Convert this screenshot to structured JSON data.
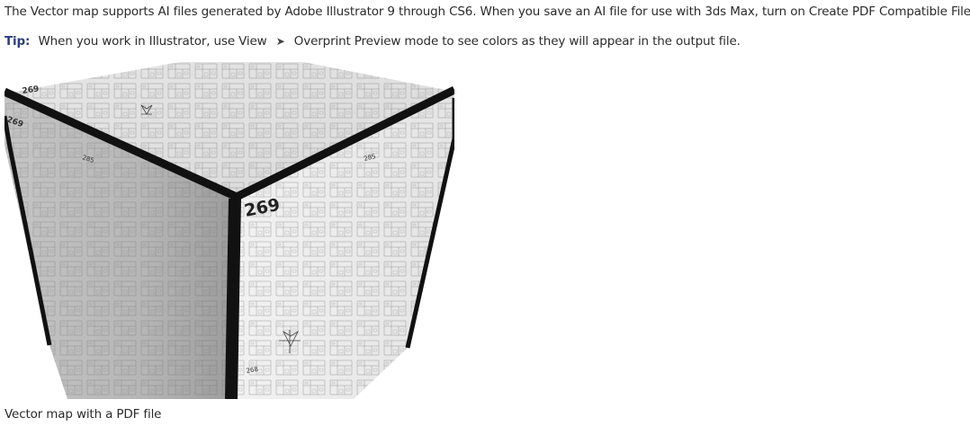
{
  "content": {
    "paragraph": "The Vector map supports AI files generated by Adobe Illustrator 9 through CS6. When you save an AI file for use with 3ds Max, turn on Create PDF Compatible File.",
    "tip": {
      "label": "Tip:",
      "text_before": "When you work in Illustrator, use View",
      "arrow": "➤",
      "text_after": "Overprint Preview mode to see colors as they will appear in the output file."
    },
    "figure": {
      "icon": "rendered-cube-with-vector-map-image",
      "labels": {
        "main": "269",
        "top_left": "269",
        "left_edge": "269",
        "left_face": "285",
        "top_right": "285",
        "bottom": "268"
      }
    },
    "caption": "Vector map with a PDF file"
  },
  "colors": {
    "text": "#2b2b2b",
    "tip_label": "#2c3e7a"
  }
}
